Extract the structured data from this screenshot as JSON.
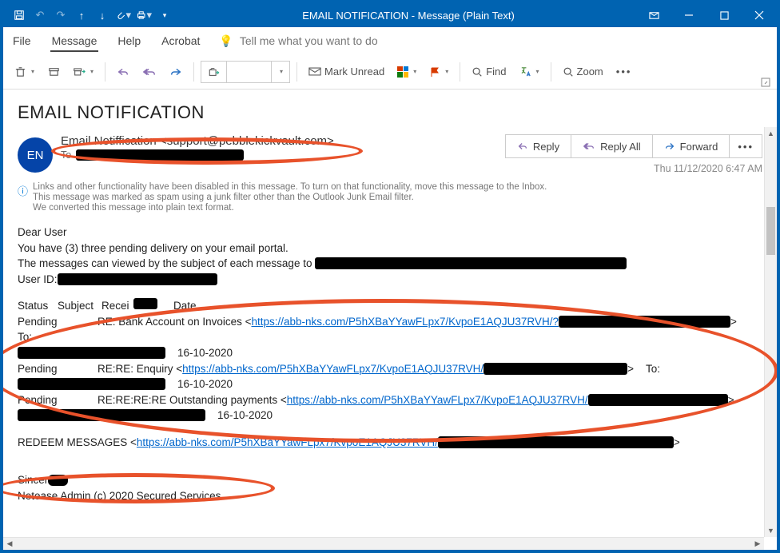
{
  "window": {
    "title": "EMAIL NOTIFICATION  -  Message (Plain Text)"
  },
  "menu": {
    "file": "File",
    "message": "Message",
    "help": "Help",
    "acrobat": "Acrobat",
    "tellme": "Tell me what you want to do"
  },
  "toolbar": {
    "mark_unread": "Mark Unread",
    "find": "Find",
    "zoom": "Zoom"
  },
  "header": {
    "subject": "EMAIL NOTIFICATION",
    "avatar_initials": "EN",
    "sender": "Email Notiffication <support@pebblekickvault.com>",
    "to_label": "To",
    "datetime": "Thu 11/12/2020 6:47 AM",
    "actions": {
      "reply": "Reply",
      "reply_all": "Reply All",
      "forward": "Forward"
    }
  },
  "notices": {
    "l1": "Links and other functionality have been disabled in this message. To turn on that functionality, move this message to the Inbox.",
    "l2": "This message was marked as spam using a junk filter other than the Outlook Junk Email filter.",
    "l3": "We converted this message into plain text format."
  },
  "body": {
    "greeting": "Dear User",
    "line_pending": "You have (3) three pending delivery on your email portal.",
    "line_viewed_prefix": "The messages can viewed by the subject of each message to ",
    "userid_label": "User ID:",
    "columns": {
      "status": "Status",
      "subject": "Subject",
      "recipient": "Recipient",
      "date": "Date"
    },
    "rows": [
      {
        "status": "Pending",
        "subject_prefix": "RE: Bank Account on Invoices <",
        "url": "https://abb-nks.com/P5hXBaYYawFLpx7/KvpoE1AQJU37RVH/?",
        "to_label": "To:",
        "date": "16-10-2020"
      },
      {
        "status": "Pending",
        "subject_prefix": "RE:RE: Enquiry <",
        "url": "https://abb-nks.com/P5hXBaYYawFLpx7/KvpoE1AQJU37RVH/",
        "to_label": "To:",
        "date": "16-10-2020"
      },
      {
        "status": "Pending",
        "subject_prefix": "RE:RE:RE:RE Outstanding payments <",
        "url": "https://abb-nks.com/P5hXBaYYawFLpx7/KvpoE1AQJU37RVH/",
        "date": "16-10-2020"
      }
    ],
    "redeem_prefix": "REDEEM MESSAGES <",
    "redeem_url": "https://abb-nks.com/P5hXBaYYawFLpx7/KvpoE1AQJU37RVH/",
    "signoff": "Sincerely,",
    "footer": "Netease Admin (c) 2020 Secured Services"
  }
}
